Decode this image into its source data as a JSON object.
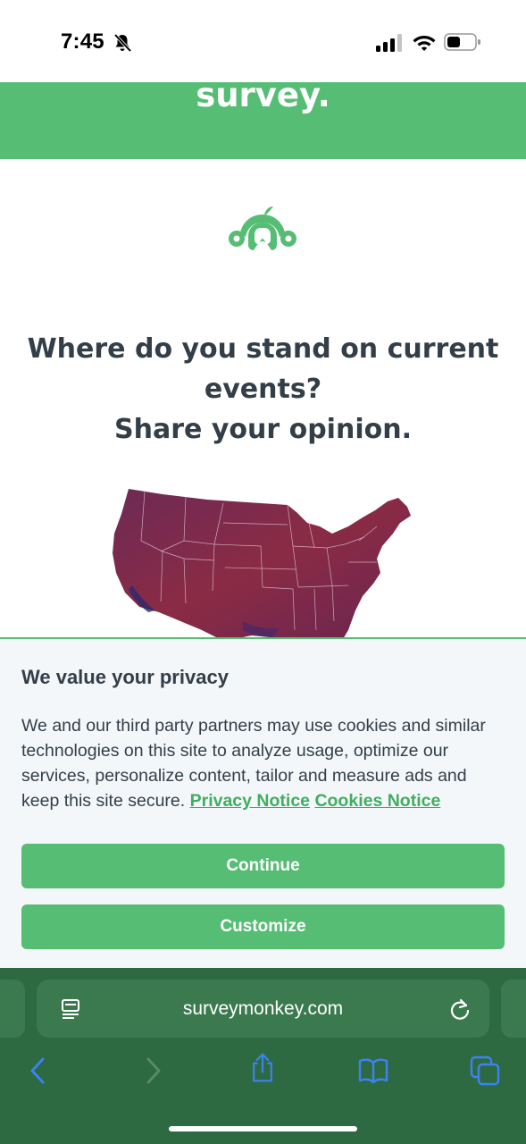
{
  "status_bar": {
    "time": "7:45"
  },
  "banner": {
    "text": "survey."
  },
  "headline": {
    "line1": "Where do you stand on current",
    "line2": "events?",
    "line3": "Share your opinion."
  },
  "privacy": {
    "title": "We value your privacy",
    "body": "We and our third party partners may use cookies and similar technologies on this site to analyze usage, optimize our services, personalize content, tailor and measure ads and keep this site secure.",
    "privacy_notice_link": "Privacy Notice",
    "cookies_notice_link": "Cookies Notice",
    "continue_label": "Continue",
    "customize_label": "Customize"
  },
  "browser": {
    "url": "surveymonkey.com"
  },
  "colors": {
    "brand_green": "#56bd74",
    "browser_green": "#2e6a41",
    "map_fill": "#7a2a4a",
    "ui_blue": "#3b82f6"
  },
  "icons": [
    "bell-slash-icon",
    "cellular-signal-icon",
    "wifi-icon",
    "battery-icon",
    "surveymonkey-logo",
    "reader-icon",
    "reload-icon",
    "back-icon",
    "forward-icon",
    "share-icon",
    "bookmarks-icon",
    "tabs-icon"
  ]
}
